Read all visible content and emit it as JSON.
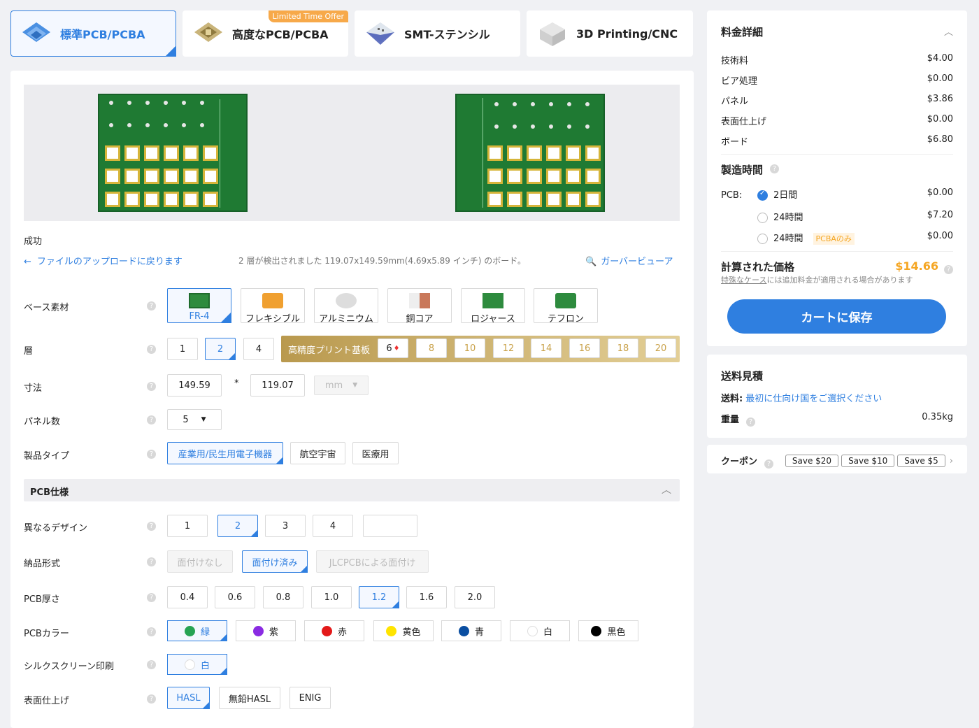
{
  "tabs": [
    {
      "label": "標準PCB/PCBA",
      "active": true
    },
    {
      "label": "高度なPCB/PCBA",
      "badge": "Limited Time Offer"
    },
    {
      "label": "SMT-ステンシル"
    },
    {
      "label": "3D Printing/CNC"
    }
  ],
  "upload": {
    "status": "成功",
    "back_link": "ファイルのアップロードに戻ります",
    "detect_info": "2 層が検出されました 119.07x149.59mm(4.69x5.89 インチ) のボード。",
    "gerber_viewer": "ガーバービューア"
  },
  "form": {
    "base_material": {
      "label": "ベース素材",
      "options": [
        "FR-4",
        "フレキシブル",
        "アルミニウム",
        "銅コア",
        "ロジャース",
        "テフロン"
      ],
      "selected": "FR-4"
    },
    "layers": {
      "label": "層",
      "options": [
        "1",
        "2",
        "4"
      ],
      "selected": "2",
      "hd_label": "高精度プリント基板",
      "hd_options": [
        "6",
        "8",
        "10",
        "12",
        "14",
        "16",
        "18",
        "20"
      ]
    },
    "dimensions": {
      "label": "寸法",
      "width": "149.59",
      "sep": "*",
      "height": "119.07",
      "unit": "mm"
    },
    "panel_qty": {
      "label": "パネル数",
      "value": "5"
    },
    "product_type": {
      "label": "製品タイプ",
      "options": [
        "産業用/民生用電子機器",
        "航空宇宙",
        "医療用"
      ],
      "selected": "産業用/民生用電子機器"
    },
    "pcb_spec_header": "PCB仕様",
    "different_designs": {
      "label": "異なるデザイン",
      "options": [
        "1",
        "2",
        "3",
        "4"
      ],
      "selected": "2"
    },
    "delivery_format": {
      "label": "納品形式",
      "options": [
        "面付けなし",
        "面付け済み",
        "JLCPCBによる面付け"
      ],
      "selected": "面付け済み"
    },
    "thickness": {
      "label": "PCB厚さ",
      "options": [
        "0.4",
        "0.6",
        "0.8",
        "1.0",
        "1.2",
        "1.6",
        "2.0"
      ],
      "selected": "1.2"
    },
    "color": {
      "label": "PCBカラー",
      "options": [
        {
          "name": "緑",
          "hex": "#27a353"
        },
        {
          "name": "紫",
          "hex": "#8a2be2"
        },
        {
          "name": "赤",
          "hex": "#e31919"
        },
        {
          "name": "黄色",
          "hex": "#ffe400"
        },
        {
          "name": "青",
          "hex": "#0a4ea1"
        },
        {
          "name": "白",
          "hex": "#ffffff"
        },
        {
          "name": "黒色",
          "hex": "#000000"
        }
      ],
      "selected": "緑"
    },
    "silkscreen": {
      "label": "シルクスクリーン印刷",
      "value": "白"
    },
    "surface_finish": {
      "label": "表面仕上げ",
      "options": [
        "HASL",
        "無鉛HASL",
        "ENIG"
      ],
      "selected": "HASL"
    }
  },
  "price": {
    "title": "料金詳細",
    "items": [
      {
        "label": "技術料",
        "value": "$4.00"
      },
      {
        "label": "ビア処理",
        "value": "$0.00"
      },
      {
        "label": "パネル",
        "value": "$3.86"
      },
      {
        "label": "表面仕上げ",
        "value": "$0.00"
      },
      {
        "label": "ボード",
        "value": "$6.80"
      }
    ],
    "build_time_title": "製造時間",
    "pcb_label": "PCB:",
    "build_options": [
      {
        "label": "2日間",
        "value": "$0.00",
        "selected": true
      },
      {
        "label": "24時間",
        "value": "$7.20"
      },
      {
        "label": "24時間",
        "badge": "PCBAのみ",
        "value": "$0.00"
      }
    ],
    "calculated_label": "計算された価格",
    "calculated_value": "$14.66",
    "special_link": "特殊なケース",
    "special_note": " には追加料金が適用される場合があります",
    "save_button": "カートに保存"
  },
  "shipping": {
    "title": "送料見積",
    "fee_label": "送料:",
    "fee_link": "最初に仕向け国をご選択ください",
    "weight_label": "重量",
    "weight_value": "0.35kg"
  },
  "coupon": {
    "label": "クーポン",
    "items": [
      "Save $20",
      "Save $10",
      "Save $5"
    ]
  },
  "colors": {
    "accent": "#2f7fe0",
    "price": "#f5a623",
    "board": "#1f7a33"
  }
}
